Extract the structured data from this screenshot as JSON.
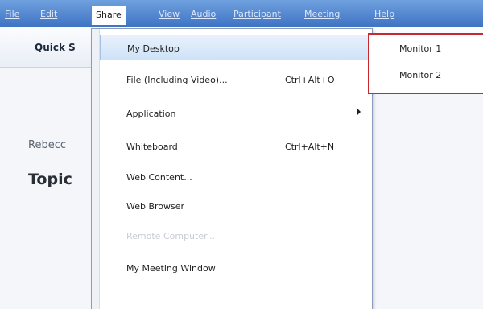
{
  "menubar": {
    "items": [
      "File",
      "Edit",
      "Share",
      "View",
      "Audio",
      "Participant",
      "Meeting",
      "Help"
    ],
    "active_index": 2
  },
  "background": {
    "toolbar_label": "Quick S",
    "name_text": "Rebecc",
    "topic_text": "Topic"
  },
  "share_menu": {
    "items": [
      {
        "label": "My Desktop",
        "shortcut": "",
        "has_submenu": false,
        "disabled": false,
        "highlighted": true
      },
      {
        "label": "File (Including Video)...",
        "shortcut": "Ctrl+Alt+O",
        "has_submenu": false,
        "disabled": false,
        "highlighted": false
      },
      {
        "label": "Application",
        "shortcut": "",
        "has_submenu": true,
        "disabled": false,
        "highlighted": false
      },
      {
        "label": "Whiteboard",
        "shortcut": "Ctrl+Alt+N",
        "has_submenu": false,
        "disabled": false,
        "highlighted": false
      },
      {
        "label": "Web Content...",
        "shortcut": "",
        "has_submenu": false,
        "disabled": false,
        "highlighted": false
      },
      {
        "label": "Web Browser",
        "shortcut": "",
        "has_submenu": false,
        "disabled": false,
        "highlighted": false
      },
      {
        "label": "Remote Computer...",
        "shortcut": "",
        "has_submenu": false,
        "disabled": true,
        "highlighted": false
      },
      {
        "label": "My Meeting Window",
        "shortcut": "",
        "has_submenu": false,
        "disabled": false,
        "highlighted": false
      }
    ]
  },
  "desktop_submenu": {
    "items": [
      "Monitor 1",
      "Monitor 2"
    ],
    "border_color": "#c8282e"
  }
}
